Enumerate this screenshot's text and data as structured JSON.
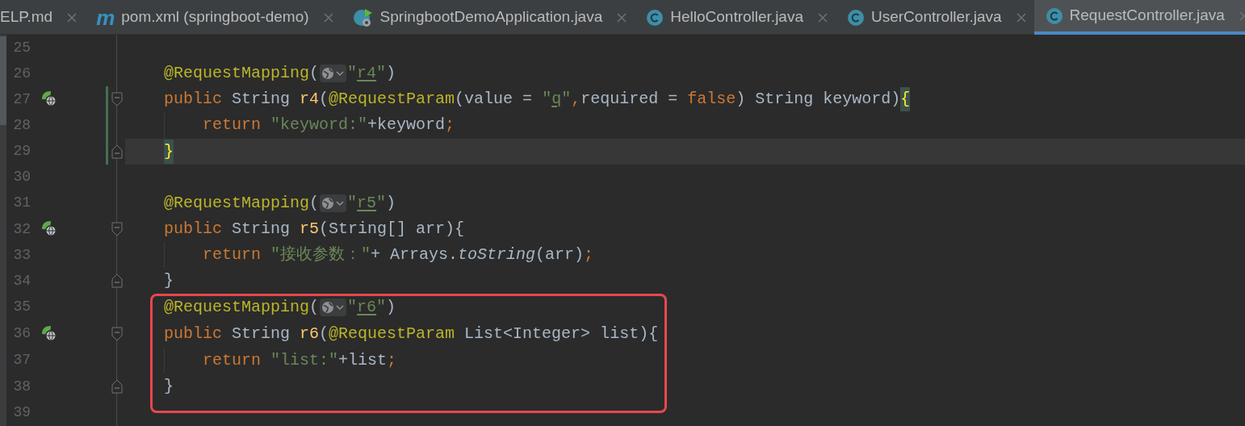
{
  "tabs": [
    {
      "label": "ELP.md",
      "kind": "markdown",
      "selected": false
    },
    {
      "label": "pom.xml (springboot-demo)",
      "kind": "maven",
      "icon_label": "m",
      "selected": false
    },
    {
      "label": "SpringbootDemoApplication.java",
      "kind": "spring",
      "selected": false
    },
    {
      "label": "HelloController.java",
      "kind": "class",
      "selected": false
    },
    {
      "label": "UserController.java",
      "kind": "class",
      "selected": false
    },
    {
      "label": "RequestController.java",
      "kind": "class",
      "selected": true
    }
  ],
  "editor": {
    "lines": [
      {
        "number": "25",
        "kind": "blank",
        "marker": false,
        "changed": false,
        "current": false
      },
      {
        "number": "26",
        "kind": "member",
        "marker": false,
        "changed": false,
        "current": false,
        "tokens": [
          {
            "kind": "annotation",
            "text": "@RequestMapping"
          },
          {
            "kind": "plain",
            "text": "("
          },
          {
            "kind": "inlay"
          },
          {
            "kind": "string",
            "text": "\""
          },
          {
            "kind": "url",
            "text": "r4"
          },
          {
            "kind": "string",
            "text": "\""
          },
          {
            "kind": "plain",
            "text": ")"
          }
        ]
      },
      {
        "number": "27",
        "kind": "member",
        "marker": true,
        "fold": {
          "kind": "start"
        },
        "changed": true,
        "current": false,
        "tokens": [
          {
            "kind": "keyword",
            "text": "public"
          },
          {
            "kind": "plain",
            "text": " String "
          },
          {
            "kind": "method",
            "text": "r4"
          },
          {
            "kind": "plain",
            "text": "("
          },
          {
            "kind": "annotation",
            "text": "@RequestParam"
          },
          {
            "kind": "plain",
            "text": "(value = "
          },
          {
            "kind": "string",
            "text": "\""
          },
          {
            "kind": "url",
            "text": "q"
          },
          {
            "kind": "string",
            "text": "\""
          },
          {
            "kind": "keyword",
            "text": ","
          },
          {
            "kind": "plain",
            "text": "required = "
          },
          {
            "kind": "keyword",
            "text": "false"
          },
          {
            "kind": "plain",
            "text": ") String keyword)"
          },
          {
            "kind": "brace_match",
            "text": "{"
          }
        ]
      },
      {
        "number": "28",
        "kind": "statement",
        "marker": false,
        "changed": true,
        "current": false,
        "tokens": [
          {
            "kind": "keyword",
            "text": "return"
          },
          {
            "kind": "string",
            "text": " \"keyword:\""
          },
          {
            "kind": "plain",
            "text": "+keyword"
          },
          {
            "kind": "keyword",
            "text": ";"
          }
        ]
      },
      {
        "number": "29",
        "kind": "member",
        "marker": false,
        "fold": {
          "kind": "end"
        },
        "changed": true,
        "current": true,
        "tokens": [
          {
            "kind": "brace_match",
            "text": "}"
          }
        ]
      },
      {
        "number": "30",
        "kind": "blank",
        "marker": false,
        "changed": false,
        "current": false
      },
      {
        "number": "31",
        "kind": "member",
        "marker": false,
        "changed": false,
        "current": false,
        "tokens": [
          {
            "kind": "annotation",
            "text": "@RequestMapping"
          },
          {
            "kind": "plain",
            "text": "("
          },
          {
            "kind": "inlay"
          },
          {
            "kind": "string",
            "text": "\""
          },
          {
            "kind": "url",
            "text": "r5"
          },
          {
            "kind": "string",
            "text": "\""
          },
          {
            "kind": "plain",
            "text": ")"
          }
        ]
      },
      {
        "number": "32",
        "kind": "member",
        "marker": true,
        "fold": {
          "kind": "start"
        },
        "changed": false,
        "current": false,
        "tokens": [
          {
            "kind": "keyword",
            "text": "public"
          },
          {
            "kind": "plain",
            "text": " String "
          },
          {
            "kind": "method",
            "text": "r5"
          },
          {
            "kind": "plain",
            "text": "(String[] arr){"
          }
        ]
      },
      {
        "number": "33",
        "kind": "statement",
        "marker": false,
        "changed": false,
        "current": false,
        "tokens": [
          {
            "kind": "keyword",
            "text": "return"
          },
          {
            "kind": "string",
            "text": " \"接收参数：\""
          },
          {
            "kind": "plain",
            "text": "+ Arrays."
          },
          {
            "kind": "static_call",
            "text": "toString"
          },
          {
            "kind": "plain",
            "text": "(arr)"
          },
          {
            "kind": "keyword",
            "text": ";"
          }
        ]
      },
      {
        "number": "34",
        "kind": "member",
        "marker": false,
        "fold": {
          "kind": "end"
        },
        "changed": false,
        "current": false,
        "tokens": [
          {
            "kind": "plain",
            "text": "}"
          }
        ]
      },
      {
        "kind": "highlight_box",
        "lines": [
          {
            "number": "35",
            "kind": "member",
            "marker": false,
            "changed": false,
            "current": false,
            "tokens": [
              {
                "kind": "annotation",
                "text": "@RequestMapping"
              },
              {
                "kind": "plain",
                "text": "("
              },
              {
                "kind": "inlay"
              },
              {
                "kind": "string",
                "text": "\""
              },
              {
                "kind": "url",
                "text": "r6"
              },
              {
                "kind": "string",
                "text": "\""
              },
              {
                "kind": "plain",
                "text": ")"
              }
            ]
          },
          {
            "number": "36",
            "kind": "member",
            "marker": true,
            "fold": {
              "kind": "start"
            },
            "changed": false,
            "current": false,
            "tokens": [
              {
                "kind": "keyword",
                "text": "public"
              },
              {
                "kind": "plain",
                "text": " String "
              },
              {
                "kind": "method",
                "text": "r6"
              },
              {
                "kind": "plain",
                "text": "("
              },
              {
                "kind": "annotation",
                "text": "@RequestParam"
              },
              {
                "kind": "plain",
                "text": " List<Integer> list){"
              }
            ]
          },
          {
            "number": "37",
            "kind": "statement",
            "marker": false,
            "changed": false,
            "current": false,
            "tokens": [
              {
                "kind": "keyword",
                "text": "return"
              },
              {
                "kind": "string",
                "text": " \"list:\""
              },
              {
                "kind": "plain",
                "text": "+list"
              },
              {
                "kind": "keyword",
                "text": ";"
              }
            ]
          },
          {
            "number": "38",
            "kind": "member",
            "marker": false,
            "fold": {
              "kind": "end"
            },
            "changed": false,
            "current": false,
            "tokens": [
              {
                "kind": "plain",
                "text": "}"
              }
            ]
          }
        ]
      },
      {
        "number": "39",
        "kind": "blank",
        "marker": false,
        "changed": false,
        "current": false
      }
    ]
  }
}
